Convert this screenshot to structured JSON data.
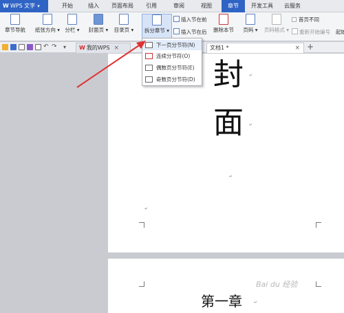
{
  "app": {
    "name": "WPS 文字",
    "logo": "W"
  },
  "menu_tabs": [
    "开始",
    "插入",
    "页面布局",
    "引用",
    "审阅",
    "视图",
    "章节",
    "开发工具",
    "云服务"
  ],
  "ribbon": {
    "section_nav": "章节导航",
    "paper_orientation": "纸张方向",
    "columns": "分栏",
    "cover_page": "封面页",
    "toc_page": "目录页",
    "split_section": "拆分章节",
    "insert_section_before": "插入节在前",
    "insert_section_after": "插入节在后",
    "delete_section": "删除本节",
    "page_number": "页码",
    "page_number_format": "页码格式",
    "first_page_different": "首页不同",
    "restart_numbering": "重新开始编号",
    "start_truncated": "起始"
  },
  "doc_tabs": [
    {
      "label": "我的WPS",
      "close": "×"
    },
    {
      "label": "文档1 *",
      "close": "×"
    }
  ],
  "new_tab": "+",
  "dropdown_items": [
    "下一页分节符(N)",
    "连续分节符(O)",
    "偶数页分节符(E)",
    "奇数页分节符(D)"
  ],
  "document": {
    "cover_char_1": "封",
    "cover_char_2": "面",
    "chapter_heading": "第一章",
    "paragraph_mark": "↵"
  },
  "watermark": "Bai du 经验",
  "colors": {
    "accent": "#2f64c4",
    "arrow": "#e03030"
  }
}
